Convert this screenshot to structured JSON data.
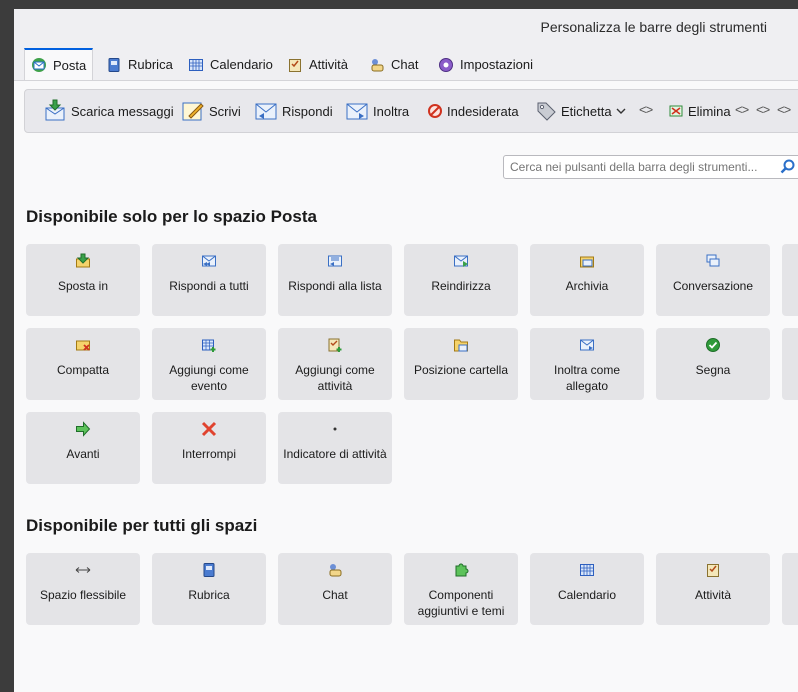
{
  "window": {
    "title": "Personalizza le barre degli strumenti"
  },
  "tabs": [
    {
      "label": "Posta",
      "icon": "mail-space-icon",
      "active": true
    },
    {
      "label": "Rubrica",
      "icon": "address-book-icon"
    },
    {
      "label": "Calendario",
      "icon": "calendar-icon"
    },
    {
      "label": "Attività",
      "icon": "tasks-icon"
    },
    {
      "label": "Chat",
      "icon": "chat-icon"
    },
    {
      "label": "Impostazioni",
      "icon": "settings-icon"
    }
  ],
  "toolbar": {
    "items": [
      {
        "label": "Scarica messaggi",
        "icon": "get-messages-icon"
      },
      {
        "label": "Scrivi",
        "icon": "write-icon"
      },
      {
        "label": "Rispondi",
        "icon": "reply-icon"
      },
      {
        "label": "Inoltra",
        "icon": "forward-icon"
      },
      {
        "label": "Indesiderata",
        "icon": "junk-icon"
      },
      {
        "label": "Etichetta",
        "icon": "tag-icon"
      },
      {
        "label": "Elimina",
        "icon": "delete-icon"
      }
    ],
    "spacer_glyph": "<>"
  },
  "search": {
    "placeholder": "Cerca nei pulsanti della barra degli strumenti..."
  },
  "sections": {
    "mail_only": {
      "title": "Disponibile solo per lo spazio Posta",
      "items": [
        {
          "label": "Sposta in",
          "icon": "move-to-icon"
        },
        {
          "label": "Rispondi a tutti",
          "icon": "reply-all-icon"
        },
        {
          "label": "Rispondi alla lista",
          "icon": "reply-list-icon"
        },
        {
          "label": "Reindirizza",
          "icon": "redirect-icon"
        },
        {
          "label": "Archivia",
          "icon": "archive-icon"
        },
        {
          "label": "Conversazione",
          "icon": "conversation-icon"
        },
        {
          "label": "Compatta",
          "icon": "compact-icon"
        },
        {
          "label": "Aggiungi come evento",
          "icon": "add-as-event-icon"
        },
        {
          "label": "Aggiungi come attività",
          "icon": "add-as-task-icon"
        },
        {
          "label": "Posizione cartella",
          "icon": "folder-location-icon"
        },
        {
          "label": "Inoltra come allegato",
          "icon": "forward-attachment-icon"
        },
        {
          "label": "Segna",
          "icon": "mark-icon"
        },
        {
          "label": "Avanti",
          "icon": "forward-arrow-icon"
        },
        {
          "label": "Interrompi",
          "icon": "stop-icon"
        },
        {
          "label": "Indicatore di attività",
          "icon": "activity-indicator-icon"
        }
      ]
    },
    "all_spaces": {
      "title": "Disponibile per tutti gli spazi",
      "items": [
        {
          "label": "Spazio flessibile",
          "icon": "flexible-space-icon"
        },
        {
          "label": "Rubrica",
          "icon": "address-book-icon"
        },
        {
          "label": "Chat",
          "icon": "chat-icon"
        },
        {
          "label": "Componenti aggiuntivi e temi",
          "icon": "addons-icon"
        },
        {
          "label": "Calendario",
          "icon": "calendar-icon"
        },
        {
          "label": "Attività",
          "icon": "tasks-icon"
        }
      ]
    }
  },
  "colors": {
    "accent": "#0060df",
    "card": "#e4e4e7",
    "background": "#f9f9fa"
  }
}
